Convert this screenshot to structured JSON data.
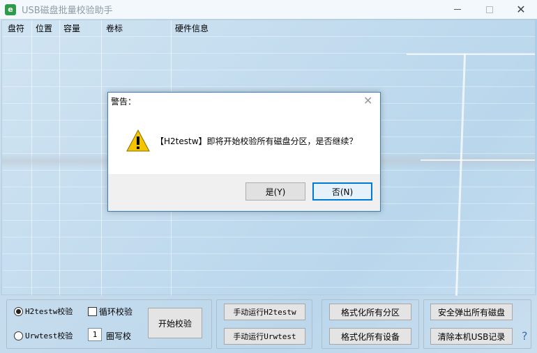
{
  "window": {
    "icon_glyph": "e",
    "title": "USB磁盘批量校验助手",
    "minimize_icon": "minimize-icon",
    "maximize_icon": "maximize-icon",
    "close_glyph": "✕"
  },
  "list": {
    "columns": [
      "盘符",
      "位置",
      "容量",
      "卷标",
      "硬件信息"
    ]
  },
  "dialog": {
    "title": "警告：",
    "close_glyph": "✕",
    "icon": "warning-icon",
    "message": "【H2testw】即将开始校验所有磁盘分区，是否继续？",
    "yes_label": "是(Y)",
    "no_label": "否(N)"
  },
  "bottom": {
    "radio_h2testw": "H2testw校验",
    "radio_urwtest": "Urwtest校验",
    "radio_selected": "H2testw校验",
    "loop_label": "循环校验",
    "loop_checked": false,
    "rounds_value": "1",
    "rounds_label": "圈写校",
    "start_button": "开始校验",
    "run_h2testw": "手动运行H2testw",
    "run_urwtest": "手动运行Urwtest",
    "format_partitions": "格式化所有分区",
    "format_devices": "格式化所有设备",
    "eject_all": "安全弹出所有磁盘",
    "clear_usb": "清除本机USB记录",
    "help_glyph": "?"
  },
  "colors": {
    "dialog_border": "#3c7fc0",
    "default_button_border": "#0078d7",
    "warning_yellow": "#f5c400"
  }
}
